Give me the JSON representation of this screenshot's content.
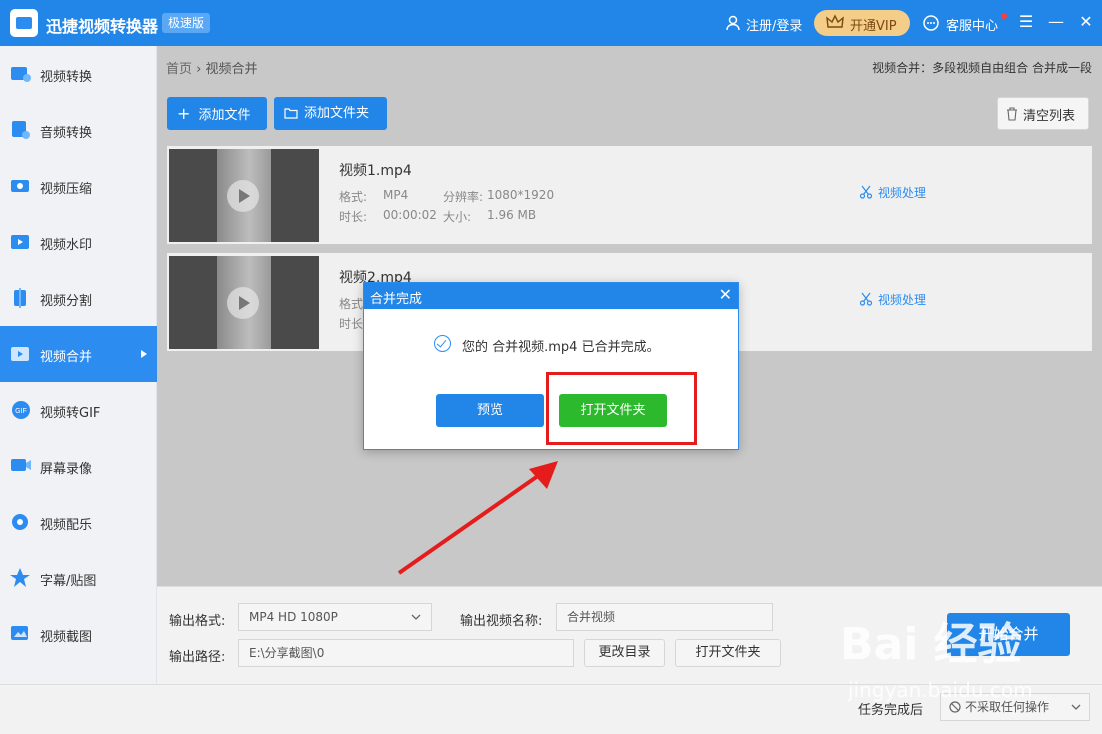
{
  "titlebar": {
    "app_title": "迅捷视频转换器",
    "badge": "极速版",
    "login": "注册/登录",
    "vip": "开通VIP",
    "service": "客服中心",
    "menu_icon": "hamburger-icon",
    "minimize_icon": "minimize-icon",
    "close_icon": "close-icon"
  },
  "sidebar": {
    "items": [
      {
        "label": "视频转换",
        "icon": "video-convert-icon",
        "color": "#2d8cf0"
      },
      {
        "label": "音频转换",
        "icon": "audio-convert-icon",
        "color": "#2d8cf0"
      },
      {
        "label": "视频压缩",
        "icon": "video-compress-icon",
        "color": "#2d8cf0"
      },
      {
        "label": "视频水印",
        "icon": "watermark-icon",
        "color": "#2d8cf0"
      },
      {
        "label": "视频分割",
        "icon": "split-icon",
        "color": "#2d8cf0"
      },
      {
        "label": "视频合并",
        "icon": "merge-icon",
        "color": "#2d8cf0"
      },
      {
        "label": "视频转GIF",
        "icon": "gif-icon",
        "color": "#2d8cf0"
      },
      {
        "label": "屏幕录像",
        "icon": "screen-record-icon",
        "color": "#2d8cf0"
      },
      {
        "label": "视频配乐",
        "icon": "music-icon",
        "color": "#2d8cf0"
      },
      {
        "label": "字幕/贴图",
        "icon": "subtitle-icon",
        "color": "#2d8cf0"
      },
      {
        "label": "视频截图",
        "icon": "screenshot-icon",
        "color": "#2d8cf0"
      }
    ],
    "active_index": 5
  },
  "breadcrumb": {
    "home": "首页",
    "sep": "›",
    "current": "视频合并"
  },
  "subtitle": "视频合并：多段视频自由组合 合并成一段",
  "toolbar": {
    "add_file": "添加文件",
    "add_folder": "添加文件夹",
    "clear": "清空列表"
  },
  "files": [
    {
      "name": "视频1.mp4",
      "format_label": "格式:",
      "format": "MP4",
      "res_label": "分辨率:",
      "resolution": "1080*1920",
      "dur_label": "时长:",
      "duration": "00:00:02",
      "size_label": "大小:",
      "size": "1.96 MB",
      "process": "视频处理"
    },
    {
      "name": "视频2.mp4",
      "format_label": "格式",
      "dur_label": "时长",
      "process": "视频处理"
    }
  ],
  "bottom": {
    "format_label": "输出格式:",
    "format_value": "MP4  HD 1080P",
    "name_label": "输出视频名称:",
    "name_value": "合并视频",
    "path_label": "输出路径:",
    "path_value": "E:\\分享截图\\0",
    "change_dir": "更改目录",
    "open_folder": "打开文件夹",
    "start": "开始合并"
  },
  "status": {
    "after_label": "任务完成后",
    "after_value": "不采取任何操作"
  },
  "modal": {
    "title": "合并完成",
    "message": "您的 合并视频.mp4 已合并完成。",
    "preview": "预览",
    "open_folder": "打开文件夹"
  },
  "watermark": {
    "brand": "Bai 经验",
    "url": "jingyan.baidu.com"
  }
}
